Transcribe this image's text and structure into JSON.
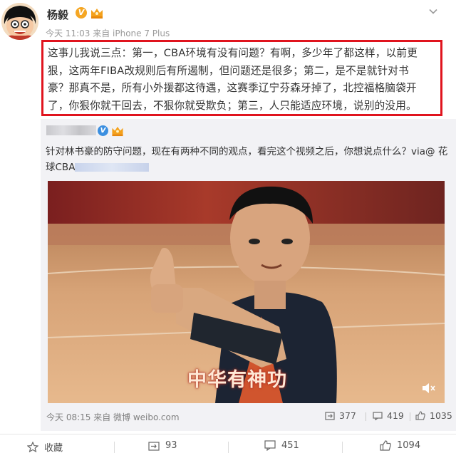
{
  "author": {
    "name": "杨毅",
    "post_time": "今天 11:03 来自 iPhone 7 Plus"
  },
  "post": {
    "lines": [
      "这事儿我说三点：第一，CBA环境有没有问题？有啊，多少年了都这样，以前更",
      "狠，这两年FIBA改规则后有所遏制，但问题还是很多；第二，是不是就针对书",
      "豪？那真不是，所有小外援都这待遇，这赛季辽宁芬森牙掉了，北控福格脑袋开",
      "了，你狠你就干回去，不狠你就受欺负；第三，人只能适应环境，说别的没用。"
    ]
  },
  "repost": {
    "text_line1": "针对林书豪的防守问题，现在有两种不同的观点，看完这个视频之后，你想说点什么？via@ 花",
    "text_line2_prefix": "球CBA",
    "video_caption": "中华有神功",
    "time": "今天 08:15 来自 微博 weibo.com",
    "reposts": "377",
    "comments": "419",
    "likes": "1035"
  },
  "actions": {
    "collect": "收藏",
    "repost": "93",
    "comment": "451",
    "like": "1094"
  },
  "colors": {
    "highlight_border": "#e0141e",
    "repost_bg": "#f2f2f5",
    "verified_orange": "#f5a623",
    "verified_blue": "#3b8fe0"
  }
}
